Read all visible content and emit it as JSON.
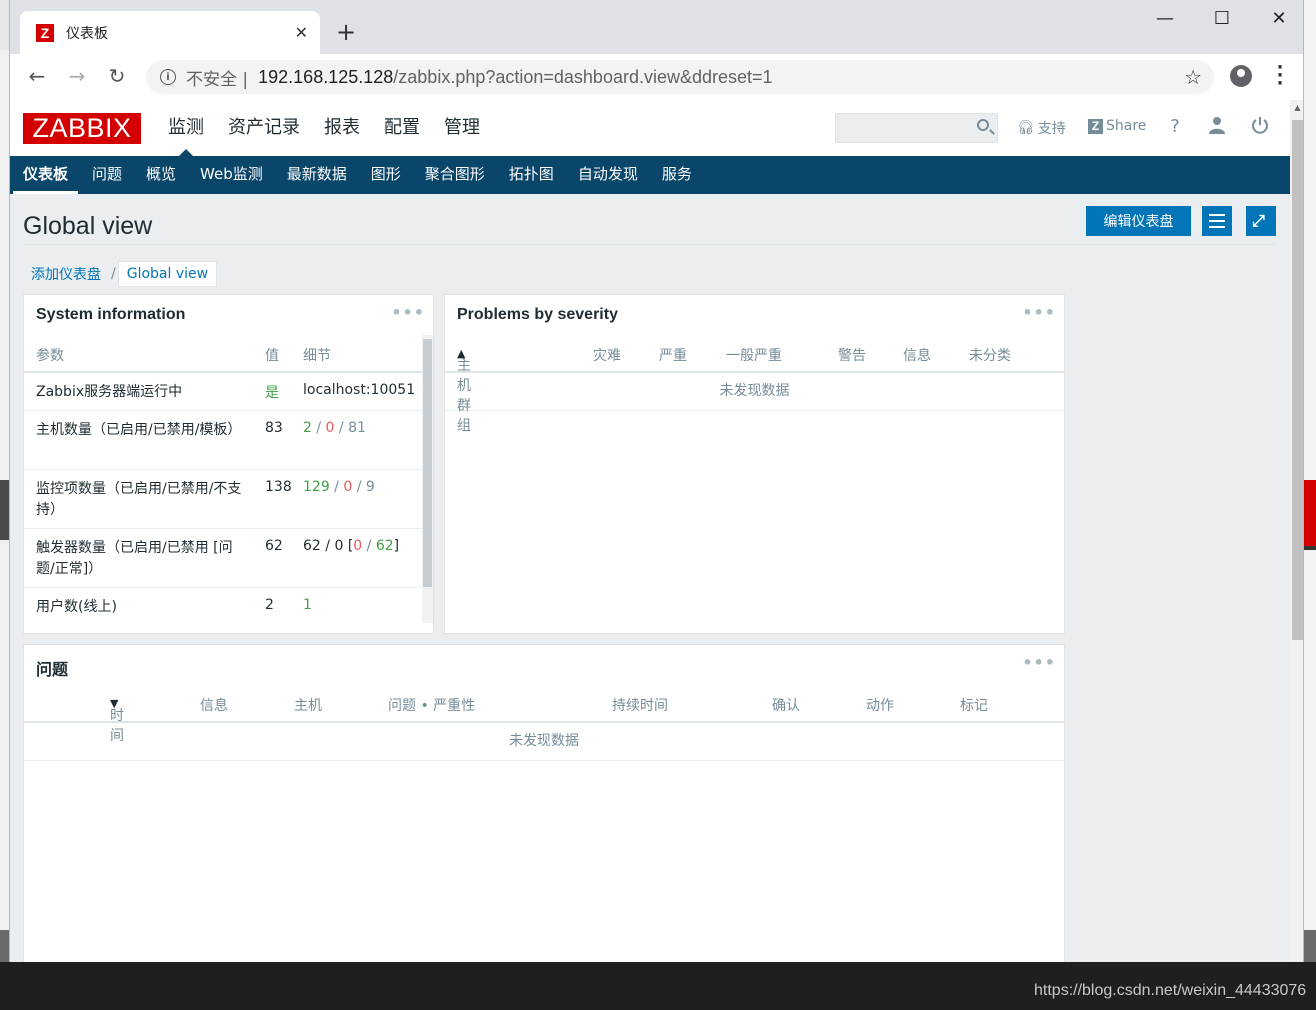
{
  "browser": {
    "tab_title": "仪表板",
    "tab_favicon": "Z",
    "insecure_label": "不安全 |",
    "url_host": "192.168.125.128",
    "url_path": "/zabbix.php?action=dashboard.view&ddreset=1"
  },
  "zabbix": {
    "logo": "ZABBIX",
    "main_nav": [
      "监测",
      "资产记录",
      "报表",
      "配置",
      "管理"
    ],
    "header_links": {
      "support": "支持",
      "share": "Share",
      "help": "?"
    },
    "sub_nav": [
      "仪表板",
      "问题",
      "概览",
      "Web监测",
      "最新数据",
      "图形",
      "聚合图形",
      "拓扑图",
      "自动发现",
      "服务"
    ],
    "page_title": "Global view",
    "edit_dashboard": "编辑仪表盘",
    "breadcrumb": [
      "添加仪表盘",
      "Global view"
    ],
    "breadcrumb_sep": "/"
  },
  "system_info": {
    "title": "System information",
    "headers": {
      "param": "参数",
      "value": "值",
      "details": "细节"
    },
    "rows": [
      {
        "param": "Zabbix服务器端运行中",
        "value": "是",
        "details": "localhost:10051"
      },
      {
        "param": "主机数量（已启用/已禁用/模板）",
        "value": "83",
        "d1": "2",
        "d2": "0",
        "d3": "81"
      },
      {
        "param": "监控项数量（已启用/已禁用/不支持）",
        "value": "138",
        "d1": "129",
        "d2": "0",
        "d3": "9"
      },
      {
        "param": "触发器数量（已启用/已禁用 [问题/正常]）",
        "value": "62",
        "d1": "62",
        "d2": "0",
        "d3": "0",
        "d4": "62"
      },
      {
        "param": "用户数(线上)",
        "value": "2",
        "details": "1"
      }
    ]
  },
  "problems_by_severity": {
    "title": "Problems by severity",
    "headers": [
      "主机群组",
      "灾难",
      "严重",
      "一般严重",
      "警告",
      "信息",
      "未分类"
    ],
    "sort_arrow": "▲",
    "no_data": "未发现数据"
  },
  "problems": {
    "title": "问题",
    "headers": [
      "时间",
      "信息",
      "主机",
      "问题 • 严重性",
      "持续时间",
      "确认",
      "动作",
      "标记"
    ],
    "sort_arrow": "▼",
    "no_data": "未发现数据"
  },
  "watermark": "https://blog.csdn.net/weixin_44433076",
  "colors": {
    "brand_red": "#d40000",
    "nav_blue": "#0a466a",
    "button_blue": "#0275b8",
    "ok_green": "#429e47",
    "problem_red": "#e45959"
  }
}
